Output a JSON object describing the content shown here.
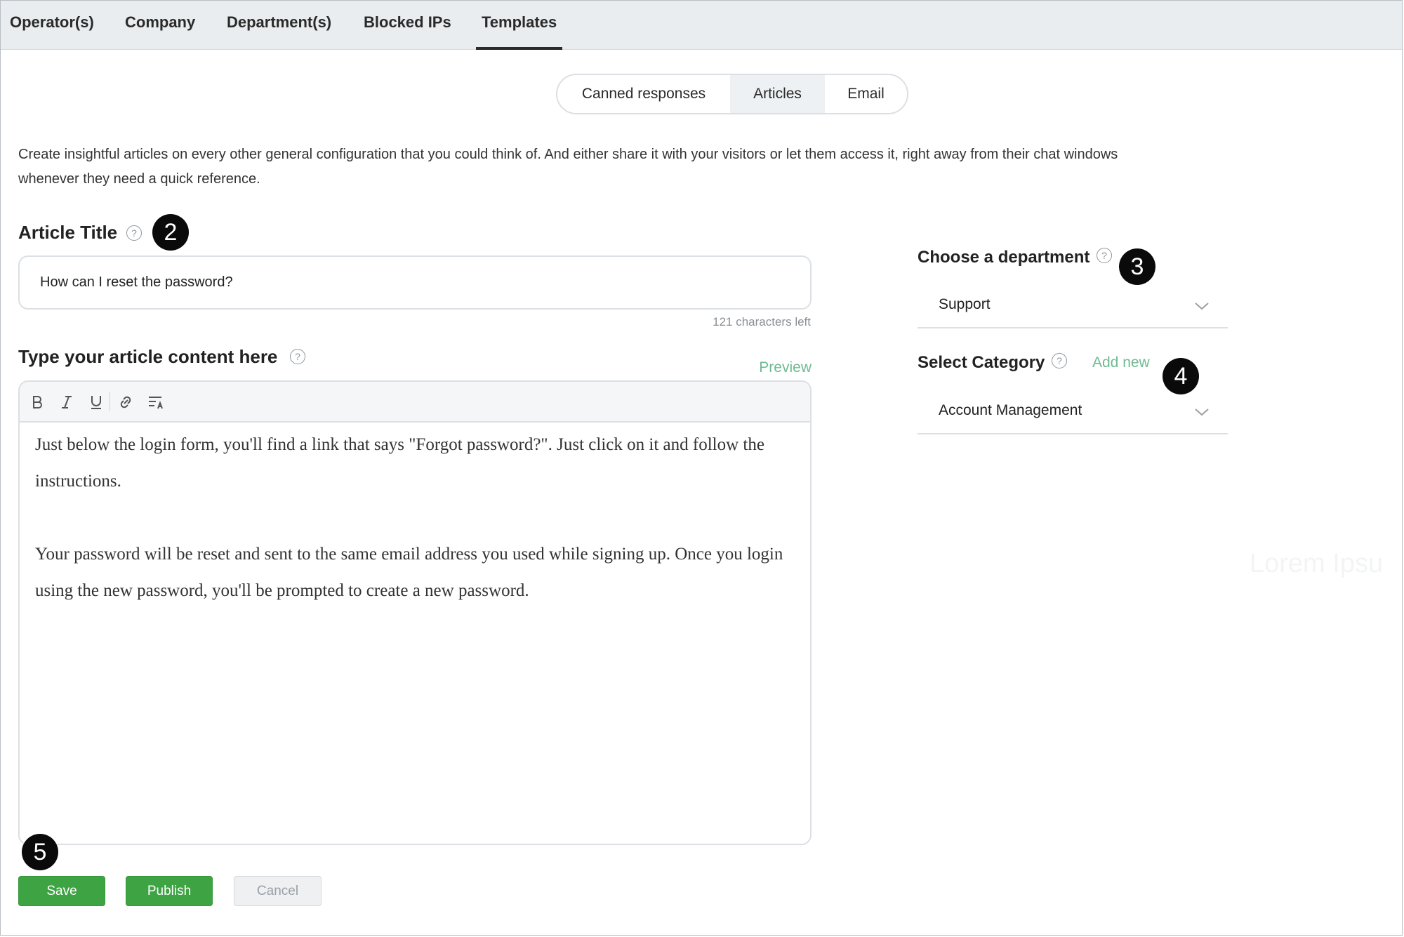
{
  "topnav": {
    "tabs": [
      {
        "label": "Operator(s)"
      },
      {
        "label": "Company"
      },
      {
        "label": "Department(s)"
      },
      {
        "label": "Blocked IPs"
      },
      {
        "label": "Templates",
        "active": true
      }
    ]
  },
  "segments": {
    "options": [
      {
        "label": "Canned responses"
      },
      {
        "label": "Articles",
        "active": true
      },
      {
        "label": "Email"
      }
    ]
  },
  "description": "Create insightful articles on every other general configuration that you could think of. And either share it with your visitors or let them access it, right away from their chat windows whenever they need a quick reference.",
  "article": {
    "title_label": "Article Title",
    "title_value": "How can I reset the password?",
    "chars_left": "121 characters left",
    "content_label": "Type your article content here",
    "preview_label": "Preview",
    "toolbar_icons": [
      "bold-icon",
      "italic-icon",
      "underline-icon",
      "link-icon",
      "text-format-icon"
    ],
    "paragraphs": [
      "Just below the login form, you'll find a link that says \"Forgot password?\". Just click on it and follow the instructions.",
      "Your password will be reset and sent to the same email address you used while signing up. Once you login using the new password, you'll be prompted to create a new password."
    ]
  },
  "department": {
    "label": "Choose a department",
    "value": "Support"
  },
  "category": {
    "label": "Select Category",
    "add_new": "Add new",
    "value": "Account Management"
  },
  "callouts": {
    "title": "2",
    "department": "3",
    "category": "4",
    "save": "5"
  },
  "help_glyph": "?",
  "buttons": {
    "save": "Save",
    "publish": "Publish",
    "cancel": "Cancel"
  },
  "watermark": "Lorem Ipsu",
  "colors": {
    "primary_green": "#3ea443",
    "link_green": "#6fba92",
    "nav_bg": "#e9edf0"
  }
}
